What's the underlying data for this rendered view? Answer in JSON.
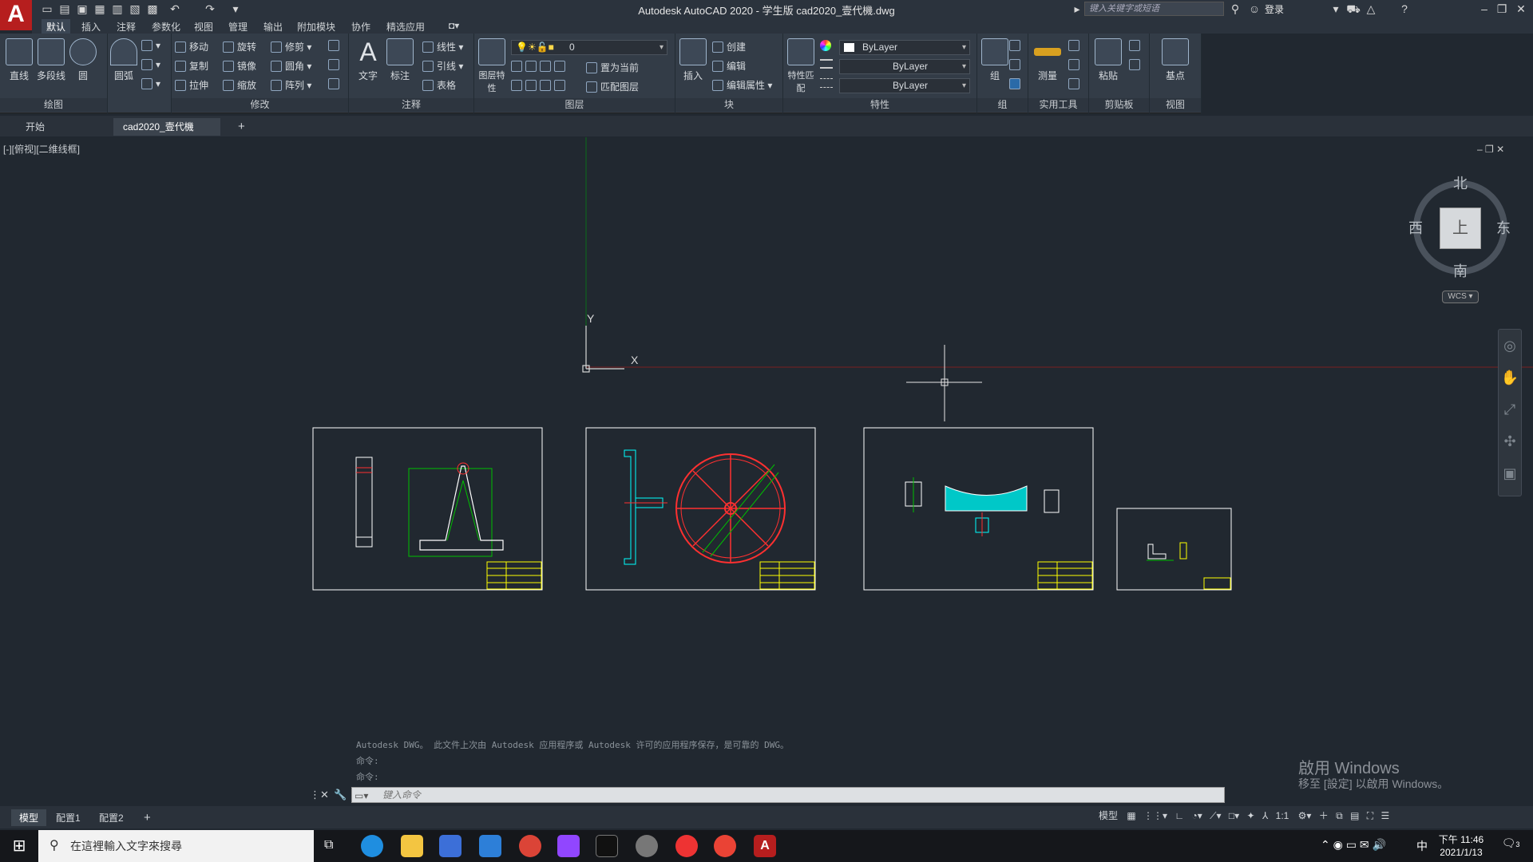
{
  "window": {
    "title": "Autodesk AutoCAD 2020 - 学生版    cad2020_壹代機.dwg",
    "search_placeholder": "键入关键字或短语",
    "login_label": "登录"
  },
  "menu": [
    "默认",
    "插入",
    "注释",
    "参数化",
    "视图",
    "管理",
    "输出",
    "附加模块",
    "协作",
    "精选应用"
  ],
  "ribbon": {
    "draw": {
      "title": "绘图",
      "tools": [
        "直线",
        "多段线",
        "圆",
        "圆弧"
      ]
    },
    "modify": {
      "title": "修改",
      "tools": [
        "移动",
        "旋转",
        "修剪",
        "复制",
        "镜像",
        "圆角",
        "拉伸",
        "缩放",
        "阵列"
      ]
    },
    "annotation": {
      "title": "注释",
      "tools": [
        "文字",
        "标注",
        "线性",
        "引线",
        "表格"
      ]
    },
    "layers": {
      "title": "图层",
      "layer_value": "0",
      "tools": [
        "图层特性",
        "置为当前",
        "匹配图层"
      ]
    },
    "block": {
      "title": "块",
      "tools": [
        "插入",
        "创建",
        "编辑",
        "编辑属性"
      ]
    },
    "properties": {
      "title": "特性",
      "match_label": "特性匹配",
      "color": "ByLayer",
      "linetype": "ByLayer",
      "lineweight": "ByLayer"
    },
    "group": {
      "title": "组",
      "tools": [
        "组"
      ]
    },
    "utilities": {
      "title": "实用工具",
      "tools": [
        "测量"
      ]
    },
    "clipboard": {
      "title": "剪贴板",
      "tools": [
        "粘贴"
      ]
    },
    "view": {
      "title": "视图",
      "tools": [
        "基点"
      ]
    }
  },
  "doc_tabs": [
    "开始",
    "cad2020_壹代機*"
  ],
  "viewport": {
    "label": "[-][俯视][二维线框]",
    "compass": {
      "north": "北",
      "south": "南",
      "east": "东",
      "west": "西",
      "top": "上"
    },
    "wcs": "WCS"
  },
  "command": {
    "history": [
      "Autodesk DWG。 此文件上次由 Autodesk 应用程序或 Autodesk 许可的应用程序保存，是可靠的 DWG。",
      "命令:",
      "命令:"
    ],
    "placeholder": "键入命令"
  },
  "layout_tabs": [
    "模型",
    "配置1",
    "配置2"
  ],
  "status": {
    "model": "模型",
    "scale": "1:1"
  },
  "watermark": {
    "line1": "啟用 Windows",
    "line2": "移至 [設定] 以啟用 Windows。"
  },
  "taskbar": {
    "search_placeholder": "在這裡輸入文字來搜尋",
    "time": "下午 11:46",
    "date": "2021/1/13",
    "ime": "中",
    "notifications": "3"
  },
  "colors": {
    "accent_green": "#00c000",
    "accent_red": "#ff3030",
    "accent_yellow": "#ffff00",
    "accent_cyan": "#00ffff",
    "sheet_frame": "#ffffff"
  }
}
